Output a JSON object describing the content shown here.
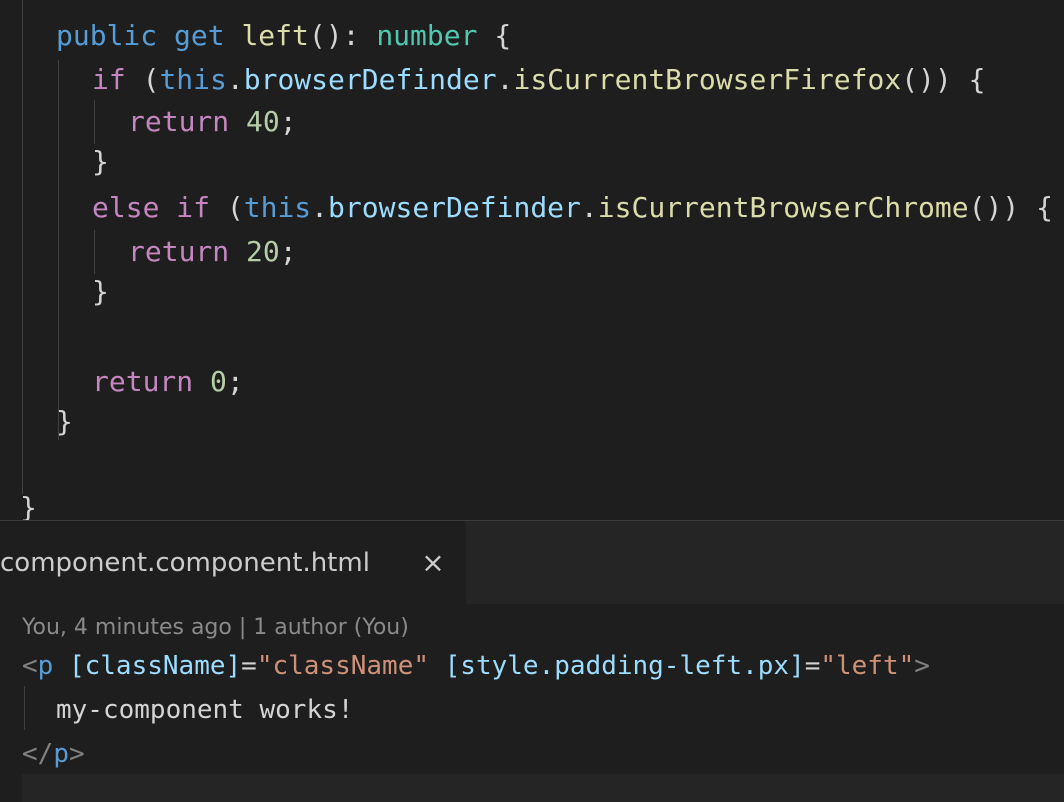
{
  "code": {
    "line1": {
      "kw1": "public",
      "kw2": "get",
      "name": "left",
      "punc": "(): ",
      "type": "number",
      "brace": " {"
    },
    "line2": {
      "ctl": "if",
      "open": " (",
      "this": "this",
      "dot1": ".",
      "prop": "browserDefinder",
      "dot2": ".",
      "fn": "isCurrentBrowserFirefox",
      "close": "()) {"
    },
    "line3": {
      "ctl": "return",
      "num": " 40",
      "semi": ";"
    },
    "line4": {
      "brace": "}"
    },
    "line5": {
      "ctl1": "else",
      "ctl2": " if",
      "open": " (",
      "this": "this",
      "dot1": ".",
      "prop": "browserDefinder",
      "dot2": ".",
      "fn": "isCurrentBrowserChrome",
      "close": "()) {"
    },
    "line6": {
      "ctl": "return",
      "num": " 20",
      "semi": ";"
    },
    "line7": {
      "brace": "}"
    },
    "line9": {
      "ctl": "return",
      "num": " 0",
      "semi": ";"
    },
    "line10": {
      "brace": "}"
    },
    "line12": {
      "brace": "}"
    }
  },
  "tab": {
    "label": "component.component.html",
    "close": "×"
  },
  "blame": "You, 4 minutes ago | 1 author (You)",
  "html": {
    "open_lt": "<",
    "tag_p": "p",
    "attr1": "[className]",
    "eq": "=",
    "val1": "\"className\"",
    "attr2": "[style.padding-left.px]",
    "val2": "\"left\"",
    "gt": ">",
    "text": "my-component works!",
    "close_lt": "</",
    "close_tag": "p",
    "close_gt": ">"
  }
}
